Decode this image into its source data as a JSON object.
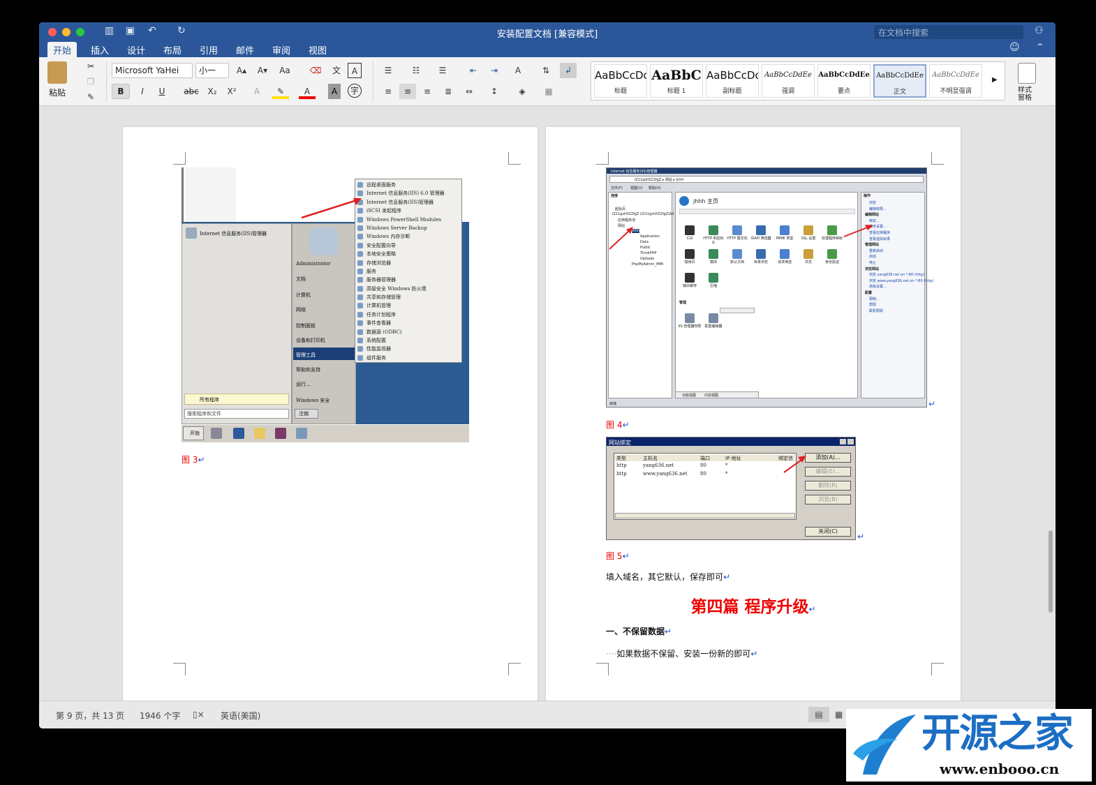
{
  "app": {
    "title": "安装配置文档 [兼容模式]",
    "search_placeholder": "在文档中搜索"
  },
  "tabs": [
    "开始",
    "插入",
    "设计",
    "布局",
    "引用",
    "邮件",
    "审阅",
    "视图"
  ],
  "ribbon": {
    "paste": "粘贴",
    "font": "Microsoft YaHei",
    "size": "小一",
    "bold": "B",
    "italic": "I",
    "underline": "U",
    "strike": "abc",
    "sub": "X₂",
    "sup": "X²",
    "style_pane": "样式\n窗格",
    "styles": [
      {
        "preview": "AaBbCcDd",
        "name": "标题"
      },
      {
        "preview": "AaBbC",
        "name": "标题 1"
      },
      {
        "preview": "AaBbCcDd",
        "name": "副标题"
      },
      {
        "preview": "AaBbCcDdEe",
        "name": "强调"
      },
      {
        "preview": "AaBbCcDdEe",
        "name": "要点"
      },
      {
        "preview": "AaBbCcDdEe",
        "name": "正文"
      },
      {
        "preview": "AaBbCcDdEe",
        "name": "不明显强调"
      }
    ]
  },
  "left_page": {
    "caption": "图 3",
    "startmenu": {
      "pinned": "Internet 信息服务(IIS)管理器",
      "user": "Administrator",
      "right": [
        "文档",
        "计算机",
        "网络",
        "控制面板",
        "设备和打印机",
        "管理工具",
        "帮助和支持",
        "运行...",
        "Windows 安全"
      ],
      "all": "所有程序",
      "search": "搜索程序和文件",
      "logoff": "注销",
      "start": "开始",
      "submenu": [
        "远程桌面服务",
        "Internet 信息服务(IIS) 6.0 管理器",
        "Internet 信息服务(IIS)管理器",
        "iSCSI 发起程序",
        "Windows PowerShell Modules",
        "Windows Server Backup",
        "Windows 内存诊断",
        "安全配置向导",
        "本地安全策略",
        "存储浏览器",
        "服务",
        "服务器管理器",
        "高级安全 Windows 防火墙",
        "共享和存储管理",
        "计算机管理",
        "任务计划程序",
        "事件查看器",
        "数据源 (ODBC)",
        "系统配置",
        "性能监视器",
        "组件服务"
      ]
    }
  },
  "right_page": {
    "fig4": "图 4",
    "fig5": "图 5",
    "iis": {
      "title": "Internet 信息服务(IIS)管理器",
      "addr": "iZ11gsh5Z2fgZ ▸ 网站 ▸ jhhh",
      "menu": [
        "文件(F)",
        "视图(V)",
        "帮助(H)"
      ],
      "home": "jhhh 主页",
      "conn": "连接",
      "actions": "操作",
      "tree": [
        "起始页",
        "iZ11gsh5Z2fgZ (iZ11gsh5Z2fgZ\\Ad",
        "应用程序池",
        "网站",
        "jhhh",
        "Application",
        "Data",
        "Public",
        "ThinkPHP",
        "Uploads",
        "PhpMyAdmin_MMI"
      ],
      "icons1": [
        "CGI",
        "HTTP 响应标头",
        "HTTP 重定向",
        "ISAPI 筛选器",
        "MIME 类型",
        "SSL 设置",
        "处理程序映射",
        "错误页",
        "模块",
        "默认文档",
        "目录浏览",
        "请求筛选",
        "日志",
        "身份验证",
        "输出缓存",
        "压缩"
      ],
      "mgmt": "管理",
      "icons2": [
        "IIS 管理器权限",
        "配置编辑器"
      ],
      "act": [
        "浏览",
        "编辑权限...",
        "编辑网站",
        "绑定...",
        "基本设置...",
        "查看应用程序",
        "查看虚拟目录",
        "管理网站",
        "重新启动",
        "启动",
        "停止",
        "浏览网站",
        "浏览 yang636.net on *:80 (http)",
        "浏览 www.yang636.net on *:80 (http)",
        "高级设置...",
        "配置",
        "限制...",
        "帮助",
        "联机帮助"
      ],
      "status": "就绪",
      "tabs": [
        "功能视图",
        "内容视图"
      ]
    },
    "binding": {
      "title": "网站绑定",
      "cols": [
        "类型",
        "主机名",
        "端口",
        "IP 地址",
        "绑定信"
      ],
      "rows": [
        [
          "http",
          "yang636.net",
          "80",
          "*"
        ],
        [
          "http",
          "www.yang636.net",
          "80",
          "*"
        ]
      ],
      "buttons": [
        "添加(A)...",
        "编辑(E)...",
        "删除(R)",
        "浏览(B)"
      ],
      "close": "关闭(C)"
    },
    "body1": "填入域名，其它默认，保存即可",
    "heading": "第四篇  程序升级",
    "h2": "一、不保留数据",
    "body2": "如果数据不保留、安装一份新的即可"
  },
  "status": {
    "page": "第 9 页，共 13 页",
    "words": "1946 个字",
    "lang": "英语(美国)"
  },
  "watermark": {
    "cn": "开源之家",
    "url": "www.enbooo.cn"
  }
}
